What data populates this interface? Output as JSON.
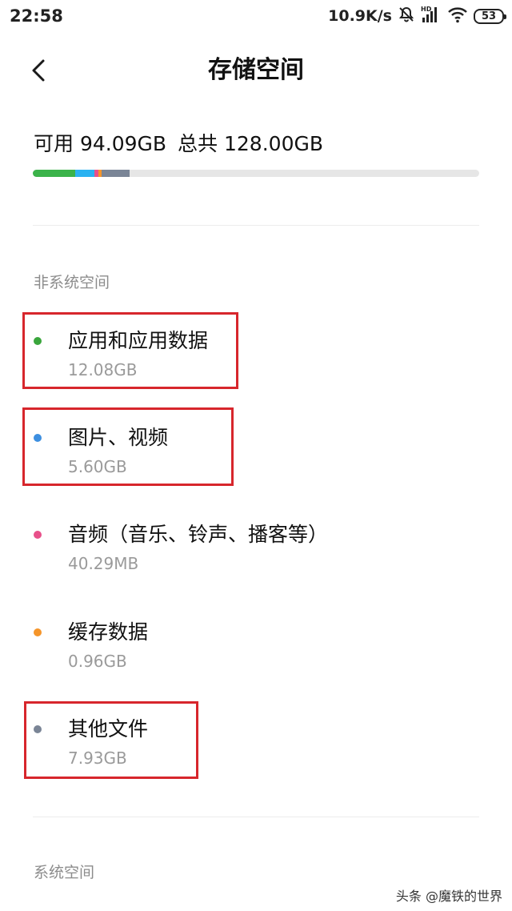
{
  "status_bar": {
    "time": "22:58",
    "net_speed": "10.9K/s",
    "battery": "53",
    "icons": [
      "mute-bell-icon",
      "hd-signal-icon",
      "wifi-icon",
      "battery-icon"
    ]
  },
  "header": {
    "title": "存储空间",
    "back_icon": "chevron-left-icon"
  },
  "summary": {
    "available": "可用 94.09GB",
    "total": "总共 128.00GB"
  },
  "usage_bar": {
    "total_gb": 128.0,
    "segments": [
      {
        "name": "应用和应用数据",
        "gb": 12.08,
        "color": "#3bb34a"
      },
      {
        "name": "图片、视频",
        "gb": 5.6,
        "color": "#2ab2f1"
      },
      {
        "name": "音频",
        "gb": 0.04,
        "color": "#e8508a"
      },
      {
        "name": "缓存数据",
        "gb": 0.96,
        "color": "#f5952a"
      },
      {
        "name": "其他文件",
        "gb": 7.93,
        "color": "#7a8596"
      }
    ]
  },
  "non_system": {
    "title": "非系统空间",
    "categories": [
      {
        "name": "应用和应用数据",
        "size": "12.08GB",
        "color": "#3aa63c",
        "highlighted": true
      },
      {
        "name": "图片、视频",
        "size": "5.60GB",
        "color": "#3d8fe0",
        "highlighted": true
      },
      {
        "name": "音频（音乐、铃声、播客等）",
        "size": "40.29MB",
        "color": "#e8508a",
        "highlighted": false
      },
      {
        "name": "缓存数据",
        "size": "0.96GB",
        "color": "#f5952a",
        "highlighted": false
      },
      {
        "name": "其他文件",
        "size": "7.93GB",
        "color": "#7a8596",
        "highlighted": true
      }
    ]
  },
  "system": {
    "title": "系统空间"
  },
  "watermark": "头条 @魔铁的世界",
  "colors": {
    "highlight_box": "#d7262c",
    "secondary_text": "#9a9a9a"
  }
}
